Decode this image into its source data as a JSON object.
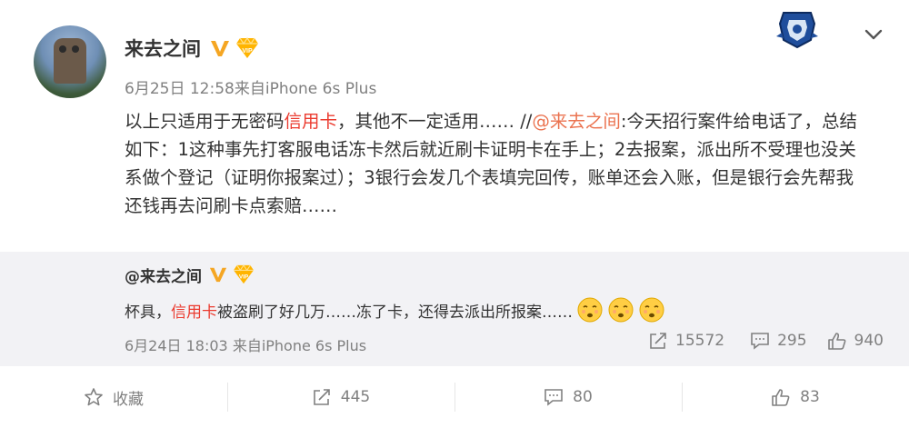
{
  "post": {
    "author": "来去之间",
    "meta": "6月25日 12:58来自iPhone 6s Plus",
    "content": {
      "p1": "以上只适用于无密码",
      "p1_hl": "信用卡",
      "p2": "，其他不一定适用…… //",
      "mention": "@来去之间",
      "p3": ":今天招行案件给电话了，总结如下：1这种事先打客服电话冻卡然后就近刷卡证明卡在手上；2去报案，派出所不受理也没关系做个登记（证明你报案过）；3银行会发几个表填完回传，账单还会入账，但是银行会先帮我还钱再去问刷卡点索赔……"
    }
  },
  "repost": {
    "author": "@来去之间",
    "text_a": "杯具，",
    "text_hl": "信用卡",
    "text_b": "被盗刷了好几万……冻了卡，还得去派出所报案……",
    "meta": "6月24日 18:03 来自iPhone 6s Plus",
    "reposts": "15572",
    "comments": "295",
    "likes": "940"
  },
  "actions": {
    "favorite": "收藏",
    "repost": "445",
    "comment": "80",
    "like": "83"
  },
  "colors": {
    "highlight_red": "#eb3b2f",
    "mention_orange": "#eb7350",
    "meta_gray": "#808080",
    "repost_bg": "#f2f2f5"
  },
  "icons": [
    "v-verified-icon",
    "vip-diamond-icon",
    "badge-icon",
    "chevron-down-icon",
    "share-icon",
    "comment-icon",
    "thumbs-up-icon",
    "star-icon",
    "emoji-icon"
  ]
}
